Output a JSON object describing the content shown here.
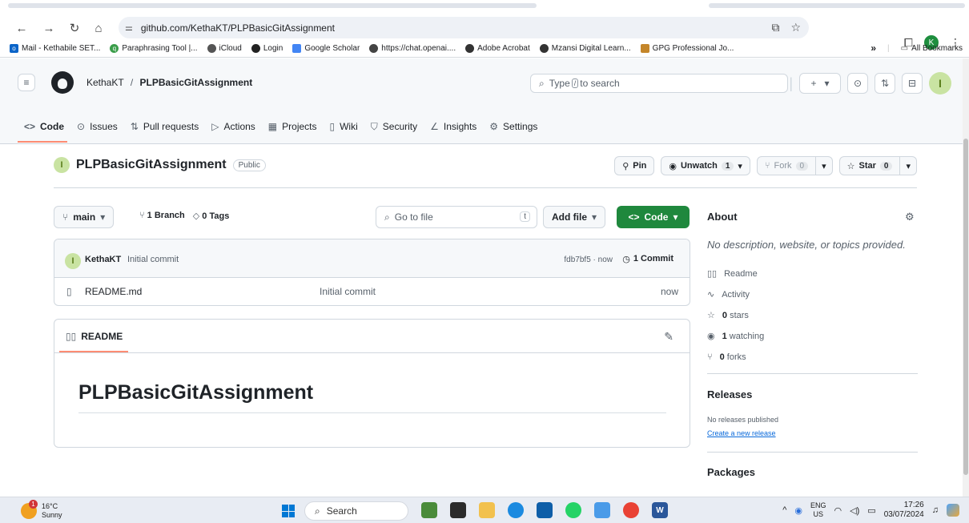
{
  "browser": {
    "url": "github.com/KethaKT/PLPBasicGitAssignment",
    "profile_initial": "K",
    "bookmarks": [
      {
        "label": "Mail - Kethabile SET...",
        "color": "#0a64c8"
      },
      {
        "label": "Paraphrasing Tool |...",
        "color": "#3a9d4a"
      },
      {
        "label": "iCloud",
        "color": "#555555"
      },
      {
        "label": "Login",
        "color": "#222222"
      },
      {
        "label": "Google Scholar",
        "color": "#4285f4"
      },
      {
        "label": "https://chat.openai....",
        "color": "#444444"
      },
      {
        "label": "Adobe Acrobat",
        "color": "#333333"
      },
      {
        "label": "Mzansi Digital Learn...",
        "color": "#333333"
      },
      {
        "label": "GPG Professional Jo...",
        "color": "#c4862a"
      }
    ],
    "bookmarks_overflow": "»",
    "all_bookmarks": "All Bookmarks"
  },
  "github": {
    "owner": "KethaKT",
    "crumb_sep": "/",
    "repo": "PLPBasicGitAssignment",
    "search_prefix": "Type",
    "search_key": "/",
    "search_suffix": "to search",
    "avatar_letter": "I",
    "tabs": [
      {
        "label": "Code",
        "icon": "<>"
      },
      {
        "label": "Issues",
        "icon": "⊙"
      },
      {
        "label": "Pull requests",
        "icon": "⇅"
      },
      {
        "label": "Actions",
        "icon": "▷"
      },
      {
        "label": "Projects",
        "icon": "▦"
      },
      {
        "label": "Wiki",
        "icon": "▯"
      },
      {
        "label": "Security",
        "icon": "⛉"
      },
      {
        "label": "Insights",
        "icon": "∠"
      },
      {
        "label": "Settings",
        "icon": "⚙"
      }
    ]
  },
  "repo_header": {
    "name": "PLPBasicGitAssignment",
    "visibility": "Public",
    "pin": "Pin",
    "unwatch": "Unwatch",
    "watch_count": "1",
    "fork": "Fork",
    "fork_count": "0",
    "star": "Star",
    "star_count": "0"
  },
  "toolbar": {
    "branch": "main",
    "branches": "1 Branch",
    "tags": "0 Tags",
    "goto_placeholder": "Go to file",
    "goto_key": "t",
    "add_file": "Add file",
    "code": "Code"
  },
  "commit": {
    "author": "KethaKT",
    "message": "Initial commit",
    "hash": "fdb7bf5 · now",
    "commits": "1 Commit"
  },
  "files": [
    {
      "name": "README.md",
      "message": "Initial commit",
      "time": "now"
    }
  ],
  "readme": {
    "tab": "README",
    "heading": "PLPBasicGitAssignment"
  },
  "about": {
    "title": "About",
    "description": "No description, website, or topics provided.",
    "items": [
      {
        "icon": "book-icon",
        "glyph": "▯▯",
        "bold": "",
        "text": "Readme"
      },
      {
        "icon": "pulse-icon",
        "glyph": "∿",
        "bold": "",
        "text": "Activity"
      },
      {
        "icon": "star-icon",
        "glyph": "☆",
        "bold": "0",
        "text": "stars"
      },
      {
        "icon": "eye-icon",
        "glyph": "◉",
        "bold": "1",
        "text": "watching"
      },
      {
        "icon": "fork-icon",
        "glyph": "⑂",
        "bold": "0",
        "text": "forks"
      }
    ],
    "releases_title": "Releases",
    "releases_none": "No releases published",
    "releases_link": "Create a new release",
    "packages_title": "Packages"
  },
  "taskbar": {
    "temp": "16°C",
    "weather": "Sunny",
    "weather_badge": "1",
    "search": "Search",
    "lang1": "ENG",
    "lang2": "US",
    "time": "17:26",
    "date": "03/07/2024"
  }
}
